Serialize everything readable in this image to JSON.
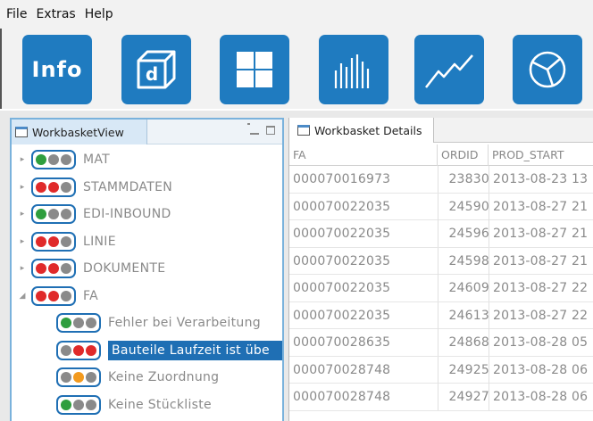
{
  "menu": [
    "File",
    "Extras",
    "Help"
  ],
  "toolbar": {
    "info_label": "Info",
    "cube_letter": "d",
    "buttons": [
      "info-button",
      "cube-button",
      "grid-button",
      "bars-button",
      "line-chart-button",
      "pie-chart-button"
    ]
  },
  "colors": {
    "accent": "#1f7bc0",
    "selection": "#1f6fb4",
    "green": "#2e9e3e",
    "red": "#e02a2a",
    "orange": "#f39a1e",
    "gray": "#8a8a8a"
  },
  "left_panel": {
    "tab_label": "WorkbasketView",
    "tree": [
      {
        "label": "MAT",
        "lights": [
          "green",
          "gray",
          "gray"
        ],
        "level": 0,
        "expander": "▸"
      },
      {
        "label": "STAMMDATEN",
        "lights": [
          "red",
          "red",
          "gray"
        ],
        "level": 0,
        "expander": "▸"
      },
      {
        "label": "EDI-INBOUND",
        "lights": [
          "green",
          "gray",
          "gray"
        ],
        "level": 0,
        "expander": "▸"
      },
      {
        "label": "LINIE",
        "lights": [
          "red",
          "red",
          "gray"
        ],
        "level": 0,
        "expander": "▸"
      },
      {
        "label": "DOKUMENTE",
        "lights": [
          "red",
          "red",
          "gray"
        ],
        "level": 0,
        "expander": "▸"
      },
      {
        "label": "FA",
        "lights": [
          "red",
          "red",
          "gray"
        ],
        "level": 0,
        "expander": "◢"
      },
      {
        "label": "Fehler bei Verarbeitung",
        "lights": [
          "green",
          "gray",
          "gray"
        ],
        "level": 1,
        "expander": ""
      },
      {
        "label": "Bauteile Laufzeit ist übe",
        "lights": [
          "gray",
          "red",
          "red"
        ],
        "level": 1,
        "expander": "",
        "selected": true
      },
      {
        "label": "Keine Zuordnung",
        "lights": [
          "gray",
          "orange",
          "gray"
        ],
        "level": 1,
        "expander": ""
      },
      {
        "label": "Keine Stückliste",
        "lights": [
          "green",
          "gray",
          "gray"
        ],
        "level": 1,
        "expander": ""
      }
    ]
  },
  "right_panel": {
    "tab_label": "Workbasket Details",
    "columns": [
      "FA",
      "ORDID",
      "PROD_START"
    ],
    "rows": [
      [
        "000070016973",
        "23830",
        "2013-08-23 13"
      ],
      [
        "000070022035",
        "24590",
        "2013-08-27 21"
      ],
      [
        "000070022035",
        "24596",
        "2013-08-27 21"
      ],
      [
        "000070022035",
        "24598",
        "2013-08-27 21"
      ],
      [
        "000070022035",
        "24609",
        "2013-08-27 22"
      ],
      [
        "000070022035",
        "24613",
        "2013-08-27 22"
      ],
      [
        "000070028635",
        "24868",
        "2013-08-28 05"
      ],
      [
        "000070028748",
        "24925",
        "2013-08-28 06"
      ],
      [
        "000070028748",
        "24927",
        "2013-08-28 06"
      ]
    ]
  }
}
